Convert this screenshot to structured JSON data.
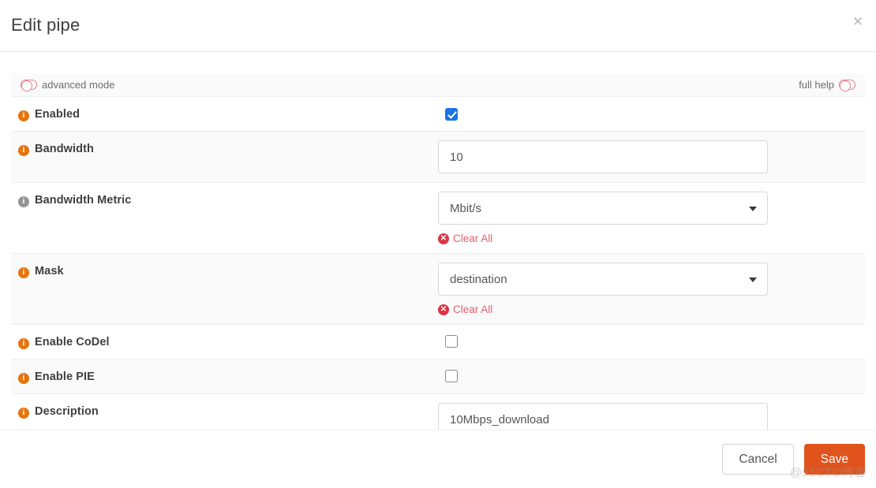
{
  "dialog": {
    "title": "Edit pipe",
    "close_label": "✕"
  },
  "toolbar": {
    "advanced_mode_label": "advanced mode",
    "full_help_label": "full help"
  },
  "icons": {
    "info_glyph": "i",
    "clear_glyph": "✕",
    "toggle_state": "off"
  },
  "colors": {
    "info_orange": "#e8730b",
    "info_grey": "#949494",
    "clear_red": "#dc3545",
    "clear_text": "#e4606d",
    "toggle_pink": "#e8808e",
    "checkbox_blue": "#1a73e8",
    "save_orange": "#e0531d"
  },
  "rows": [
    {
      "label": "Enabled",
      "info_color": "orange",
      "type": "checkbox",
      "checked": true
    },
    {
      "label": "Bandwidth",
      "info_color": "orange",
      "type": "text",
      "value": "10",
      "placeholder": "10"
    },
    {
      "label": "Bandwidth Metric",
      "info_color": "grey",
      "type": "select",
      "value": "Mbit/s",
      "clear_label": "Clear All"
    },
    {
      "label": "Mask",
      "info_color": "orange",
      "type": "select",
      "value": "destination",
      "clear_label": "Clear All"
    },
    {
      "label": "Enable CoDel",
      "info_color": "orange",
      "type": "checkbox",
      "checked": false
    },
    {
      "label": "Enable PIE",
      "info_color": "orange",
      "type": "checkbox",
      "checked": false
    },
    {
      "label": "Description",
      "info_color": "orange",
      "type": "text",
      "value": "10Mbps_download",
      "placeholder": "10Mbps_download"
    }
  ],
  "footer": {
    "cancel_label": "Cancel",
    "save_label": "Save"
  },
  "watermark": {
    "text": "@51CTO博客"
  }
}
